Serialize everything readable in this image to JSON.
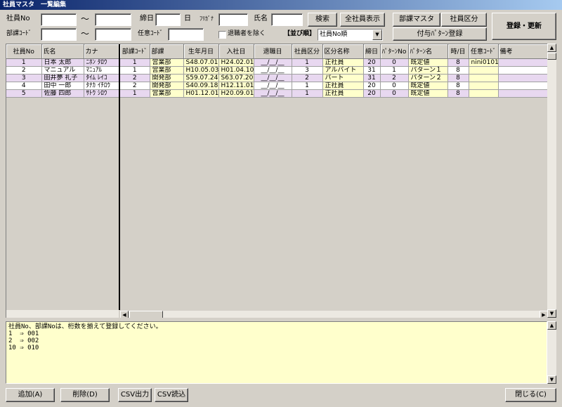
{
  "window": {
    "title": "社員マスタ　一覧編集"
  },
  "filters": {
    "emp_no_label": "社員No",
    "dept_code_label": "部課ｺｰﾄﾞ",
    "tilde": "～",
    "close_day_label": "締日",
    "day_unit": "日",
    "optional_code_label": "任意ｺｰﾄﾞ",
    "furigana_label": "ﾌﾘｶﾞﾅ",
    "name_label": "氏名",
    "exclude_retired_label": "退職者を除く",
    "sort_label": "【並び順】",
    "sort_value": "社員No順"
  },
  "buttons": {
    "search": "検索",
    "show_all": "全社員表示",
    "dept_master": "部課マスタ",
    "emp_category": "社員区分",
    "grant_pattern": "付与ﾊﾟﾀｰﾝ登録",
    "register_update": "登録・更新",
    "add": "追加(A)",
    "delete": "削除(D)",
    "csv_out": "CSV出力",
    "csv_in": "CSV読込",
    "close": "閉じる(C)"
  },
  "grid": {
    "left_columns": [
      "社員No",
      "氏名",
      "カナ"
    ],
    "right_columns": [
      "部課ｺｰﾄﾞ",
      "部課",
      "生年月日",
      "入社日",
      "退職日",
      "社員区分",
      "区分名称",
      "締日",
      "ﾊﾟﾀｰﾝNo",
      "ﾊﾟﾀｰﾝ名",
      "時/日",
      "任意ｺｰﾄﾞ",
      "備考"
    ],
    "rows": [
      {
        "no": "1",
        "name": "日本 太郎",
        "kana": "ﾆﾎﾝ ﾀﾛｳ",
        "dept_code": "1",
        "dept": "営業部",
        "birth": "S48.07.01",
        "join": "H24.02.01",
        "retire": "__/__/__",
        "cat": "1",
        "cat_name": "正社員",
        "close": "20",
        "pat_no": "0",
        "pat_name": "既定値",
        "hours": "8",
        "opt": "nini0101",
        "memo": ""
      },
      {
        "no": "2",
        "name": "マニュアル",
        "kana": "ﾏﾆｭｱﾙ",
        "dept_code": "1",
        "dept": "営業部",
        "birth": "H10.05.03",
        "join": "H01.04.10",
        "retire": "__/__/__",
        "cat": "3",
        "cat_name": "アルバイト",
        "close": "31",
        "pat_no": "1",
        "pat_name": "パターン１",
        "hours": "8",
        "opt": "",
        "memo": ""
      },
      {
        "no": "3",
        "name": "田井夢 礼子",
        "kana": "ﾀｲﾑ ﾚｲｺ",
        "dept_code": "2",
        "dept": "開発部",
        "birth": "S59.07.24",
        "join": "S63.07.20",
        "retire": "__/__/__",
        "cat": "2",
        "cat_name": "パート",
        "close": "31",
        "pat_no": "2",
        "pat_name": "パターン２",
        "hours": "8",
        "opt": "",
        "memo": ""
      },
      {
        "no": "4",
        "name": "田中 一郎",
        "kana": "ﾀﾅｶ ｲﾁﾛｳ",
        "dept_code": "2",
        "dept": "開発部",
        "birth": "S40.09.18",
        "join": "H12.11.01",
        "retire": "__/__/__",
        "cat": "1",
        "cat_name": "正社員",
        "close": "20",
        "pat_no": "0",
        "pat_name": "既定値",
        "hours": "8",
        "opt": "",
        "memo": ""
      },
      {
        "no": "5",
        "name": "佐藤 四郎",
        "kana": "ｻﾄｳ ｼﾛｳ",
        "dept_code": "1",
        "dept": "営業部",
        "birth": "H01.12.01",
        "join": "H20.09.01",
        "retire": "__/__/__",
        "cat": "1",
        "cat_name": "正社員",
        "close": "20",
        "pat_no": "0",
        "pat_name": "既定値",
        "hours": "8",
        "opt": "",
        "memo": ""
      }
    ]
  },
  "notes": {
    "line1": "社員No、部課Noは、桁数を揃えて登録してください。",
    "line2": "1  ⇒ 001",
    "line3": "2  ⇒ 002",
    "line4": "10 ⇒ 010"
  },
  "colors": {
    "title_bar": "#0a246a",
    "selected_row": "#e8d8f0",
    "editable_cell": "#ffffcc"
  }
}
